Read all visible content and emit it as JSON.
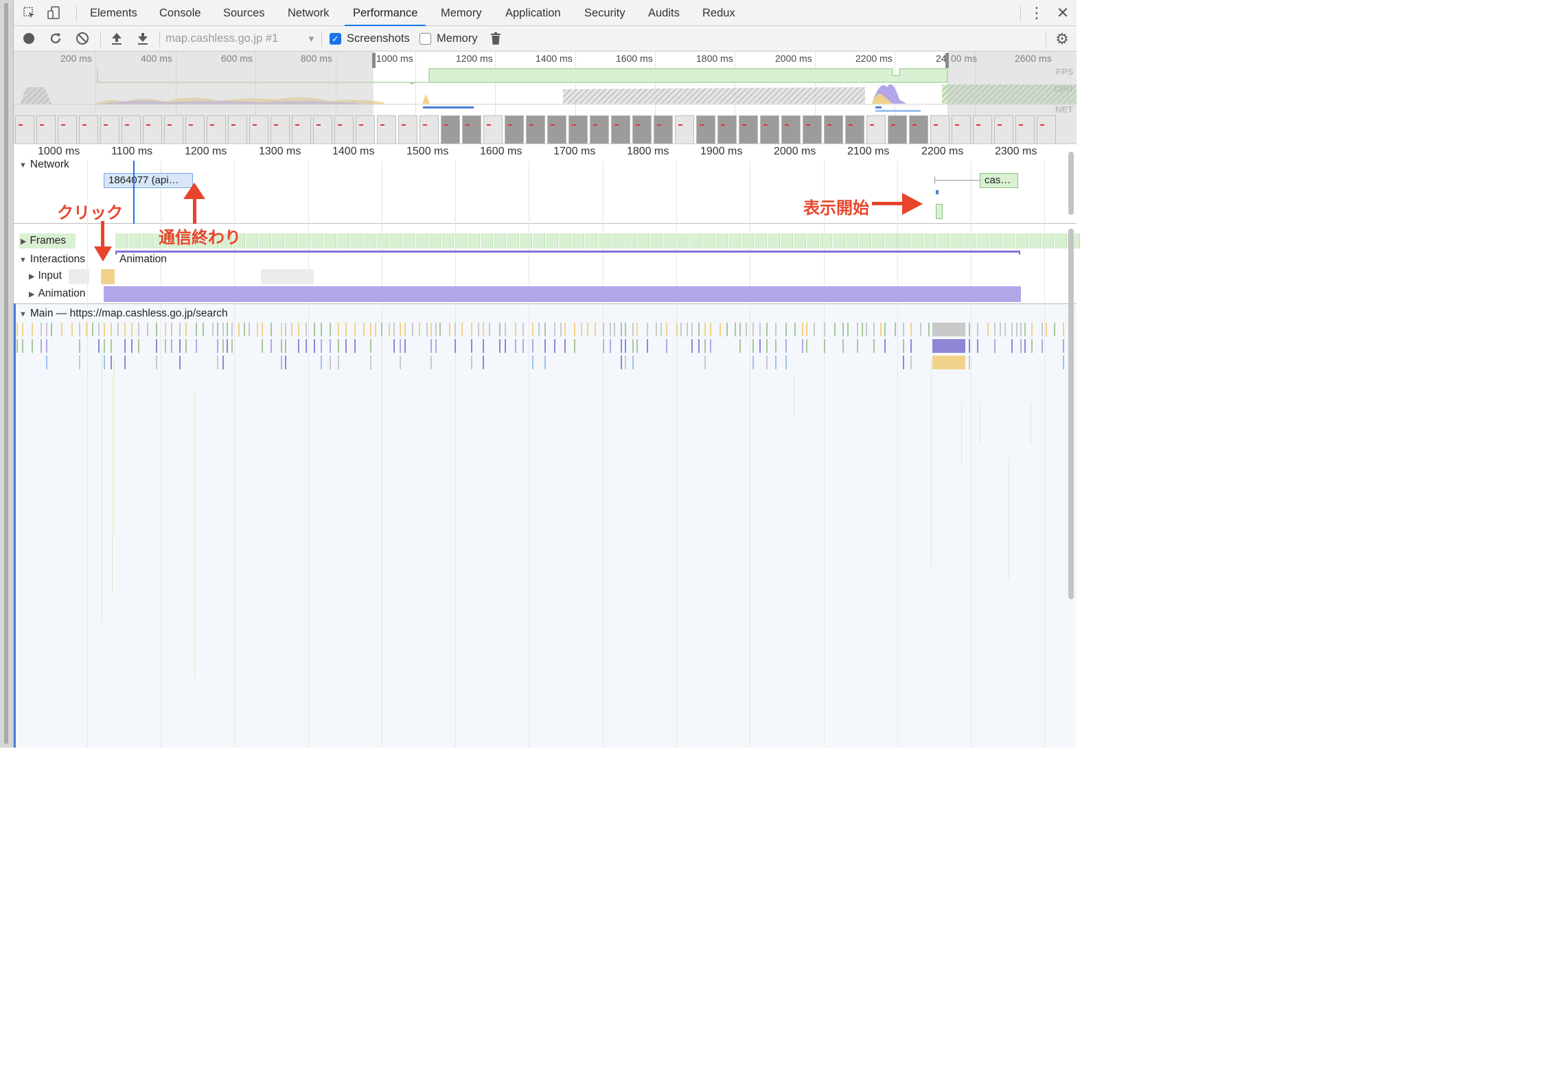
{
  "tabs": [
    {
      "label": "Elements",
      "active": false
    },
    {
      "label": "Console",
      "active": false
    },
    {
      "label": "Sources",
      "active": false
    },
    {
      "label": "Network",
      "active": false
    },
    {
      "label": "Performance",
      "active": true
    },
    {
      "label": "Memory",
      "active": false
    },
    {
      "label": "Application",
      "active": false
    },
    {
      "label": "Security",
      "active": false
    },
    {
      "label": "Audits",
      "active": false
    },
    {
      "label": "Redux",
      "active": false
    }
  ],
  "toolbar": {
    "recording_select": "map.cashless.go.jp #1",
    "screenshots_label": "Screenshots",
    "screenshots_checked": true,
    "memory_label": "Memory",
    "memory_checked": false
  },
  "overview": {
    "ticks": [
      "200 ms",
      "400 ms",
      "600 ms",
      "800 ms",
      "1000 ms",
      "1200 ms",
      "1400 ms",
      "1600 ms",
      "1800 ms",
      "2000 ms",
      "2200 ms",
      "24",
      "00 ms",
      "2600 ms"
    ],
    "lanes": [
      "FPS",
      "CPU",
      "NET"
    ]
  },
  "detail_ruler": {
    "ticks": [
      "1000 ms",
      "1100 ms",
      "1200 ms",
      "1300 ms",
      "1400 ms",
      "1500 ms",
      "1600 ms",
      "1700 ms",
      "1800 ms",
      "1900 ms",
      "2000 ms",
      "2100 ms",
      "2200 ms",
      "2300 ms"
    ]
  },
  "tracks": {
    "network": "Network",
    "network_request_1": "1864077 (api…",
    "network_request_2": "cas…",
    "resize_handle": "...",
    "frames": "Frames",
    "interactions": "Interactions",
    "interaction_animation": "Animation",
    "input": "Input",
    "animation": "Animation",
    "main": "Main — https://map.cashless.go.jp/search"
  },
  "annotations": {
    "click": "クリック",
    "fetch_end": "通信終わり",
    "display_start": "表示開始"
  },
  "colors": {
    "accent": "#1a73e8",
    "annotation": "#e8442c",
    "frame": "#d9f0d3",
    "animation": "#b3a6e8",
    "input": "#f2d28a"
  }
}
